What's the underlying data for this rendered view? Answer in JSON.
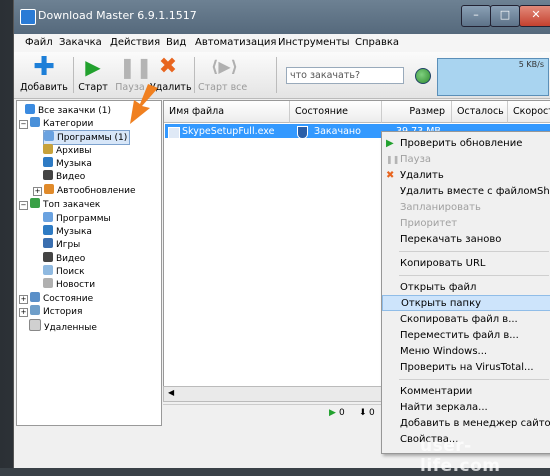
{
  "window": {
    "title": "Download Master 6.9.1.1517",
    "minimize": "–",
    "maximize": "□",
    "close": "✕"
  },
  "menu": [
    "Файл",
    "Закачка",
    "Действия",
    "Вид",
    "Автоматизация",
    "Инструменты",
    "Справка"
  ],
  "toolbar": {
    "add_label": "Добавить",
    "start_label": "Старт",
    "pause_label": "Пауза",
    "delete_label": "Удалить",
    "start_all_label": "Старт все",
    "search_placeholder": "что закачать?"
  },
  "speed": "5 KB/s",
  "tree": [
    "Все закачки (1)",
    "Категории",
    "Программы (1)",
    "Архивы",
    "Музыка",
    "Видео",
    "Автообновление",
    "Топ закачек",
    "Программы",
    "Музыка",
    "Игры",
    "Видео",
    "Поиск",
    "Новости",
    "Состояние",
    "История",
    "Удаленные"
  ],
  "columns": [
    "Имя файла",
    "Состояние",
    "Размер",
    "Осталось",
    "Скорость"
  ],
  "file_row": {
    "name": "SkypeSetupFull.exe",
    "state": "Закачано",
    "size": "39,73 MB"
  },
  "status": {
    "active": "0",
    "queued": "0"
  },
  "context_menu": {
    "check_update": "Проверить обновление",
    "pause": "Пауза",
    "delete": "Удалить",
    "delete_with_file": "Удалить вместе с файлом",
    "delete_shortcut": "Shi",
    "schedule": "Запланировать",
    "priority": "Приоритет",
    "redownload": "Перекачать заново",
    "copy_url": "Копировать URL",
    "open_file": "Открыть файл",
    "open_folder": "Открыть папку",
    "copy_file": "Скопировать файл в...",
    "move_file": "Переместить файл в...",
    "windows_menu": "Меню Windows...",
    "virustotal": "Проверить на VirusTotal...",
    "comments": "Комментарии",
    "find_mirrors": "Найти зеркала...",
    "add_to_site_manager": "Добавить в менеджер сайтов...",
    "properties": "Свойства..."
  },
  "watermark": "user-life.com",
  "colors": {
    "selection": "#3399ff",
    "arrow": "#f08020",
    "hover": "#cde4fb"
  }
}
